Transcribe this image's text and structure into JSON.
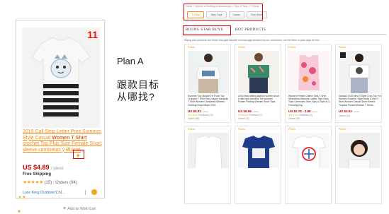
{
  "product": {
    "rank": "11",
    "title_pre": "2015 Call Strip Letter Print Summer Style Casual ",
    "title_bold": "Women T Shirt",
    "title_post": " crochet Top Plus Size Female Short sleeve camisetas y Blusas",
    "price": "US $4.89",
    "price_unit": "/ piece",
    "shipping": "Free Shipping",
    "stars": "★★★★★",
    "reviews": "(15)",
    "orders": "Orders (94)",
    "store": "Lure King Outdoor(Chi...",
    "wishlist": "Add to Wish List"
  },
  "annotation": {
    "plan": "Plan A",
    "line1": "跟款目标",
    "line2": "从哪找?"
  },
  "page": {
    "breadcrumb": "Home > Women's Clothing & Accessories > Tops & Tees > T-Shirts",
    "subtabs": [
      "T-Shirts",
      "Tank Tops",
      "Camis",
      "Polo Shirts"
    ],
    "tab_rising": "RISING STAR BUYS",
    "tab_hot": "HOT PRODUCTS",
    "desc": "Rising star products are those that gain favorite increasingly followed by our customers, we list them in past days for this",
    "points_label": "Points",
    "cards": [
      {
        "title": "Summer Top Hoodie Tie Front Top Cropped T Shirt Sexy Vague Harajuku T Shirt Women Camisetas Women Clothing Ropa Mujer 2015",
        "price": "US $5.01",
        "unit": "/ piece",
        "feedback": "Feedback (10)",
        "orders": "Orders (86)"
      },
      {
        "title": "2015 Best selling fashion women short t-shirt tops womens Tee summer Flower Printing Women Short Tops",
        "price": "US $5.59",
        "unit": "/ piece",
        "feedback": "Feedback (7)",
        "orders": "Orders (22)"
      },
      {
        "title": "Women Printed Chiffon Vest T Shirt Sleeveless Blouses Ladies Tops Sexy Tops Camisoles Tank Tops & Style A.I.L Freeshipping",
        "price": "US $2.76 - 2.89",
        "unit": "/ piece",
        "feedback": "Feedback (4)",
        "orders": "Orders (39)"
      },
      {
        "title": "Global2 2015 New 4 Style Crop Top For Women Summer Style Black & Red T Shirt Women Casual Short Sleeve Tropical Printed Women T Shirts",
        "price": "US $3.53",
        "unit": "/ piece",
        "feedback": "",
        "orders": "Orders (14)"
      }
    ]
  }
}
